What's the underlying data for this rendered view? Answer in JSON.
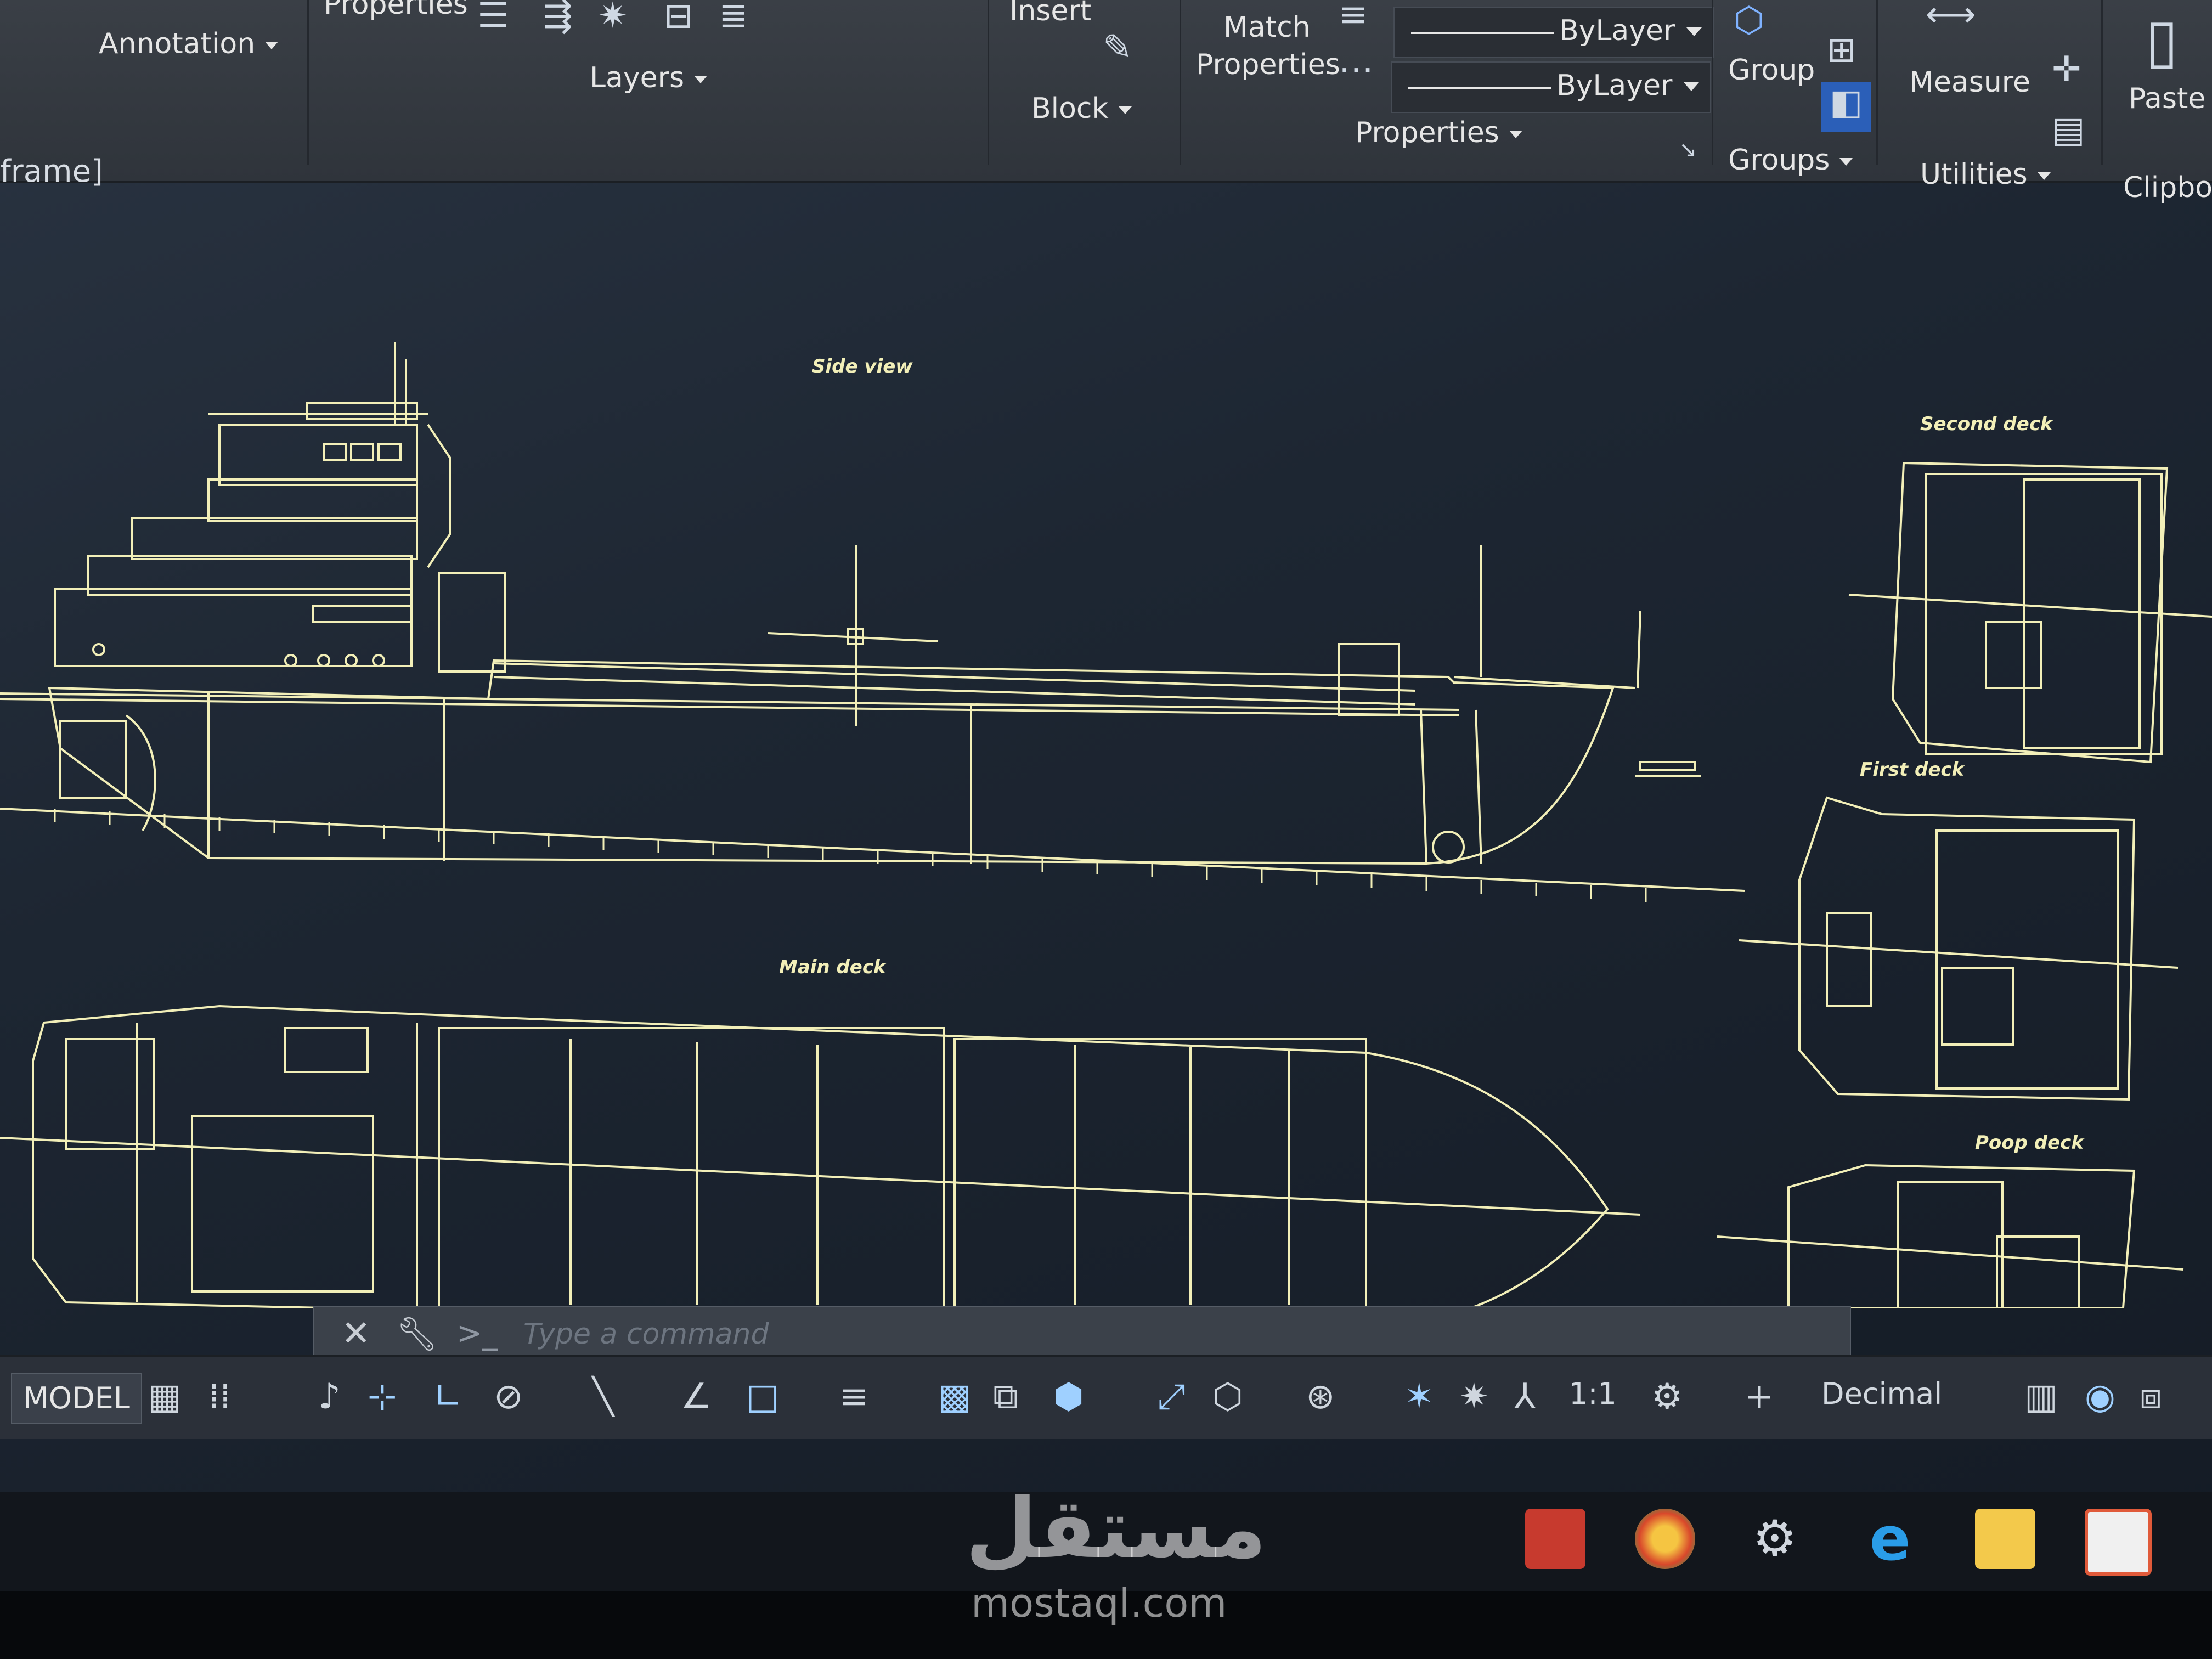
{
  "ribbon": {
    "annotation": "Annotation",
    "properties_small": "Properties",
    "layers": "Layers",
    "insert": "Insert",
    "block": "Block",
    "match_properties_line1": "Match",
    "match_properties_line2": "Properties",
    "bylayer_1": "ByLayer",
    "bylayer_2": "ByLayer",
    "properties": "Properties",
    "group": "Group",
    "groups": "Groups",
    "measure": "Measure",
    "utilities": "Utilities",
    "paste": "Paste",
    "clipboard": "Clipboa"
  },
  "viewport_label": "frame]",
  "drawing": {
    "side_view": "Side view",
    "second_deck": "Second deck",
    "first_deck": "First deck",
    "main_deck": "Main deck",
    "poop_deck": "Poop deck"
  },
  "command_line": {
    "placeholder": "Type a command",
    "prompt_symbol": ">_"
  },
  "status_bar": {
    "model_tab": "MODEL",
    "scale": "1:1",
    "units": "Decimal"
  },
  "watermark": {
    "arabic": "مستقل",
    "latin": "mostaql.com"
  },
  "colors": {
    "drawing_lines": "#f2efb8",
    "background": "#1b2430",
    "ribbon": "#353a41"
  }
}
